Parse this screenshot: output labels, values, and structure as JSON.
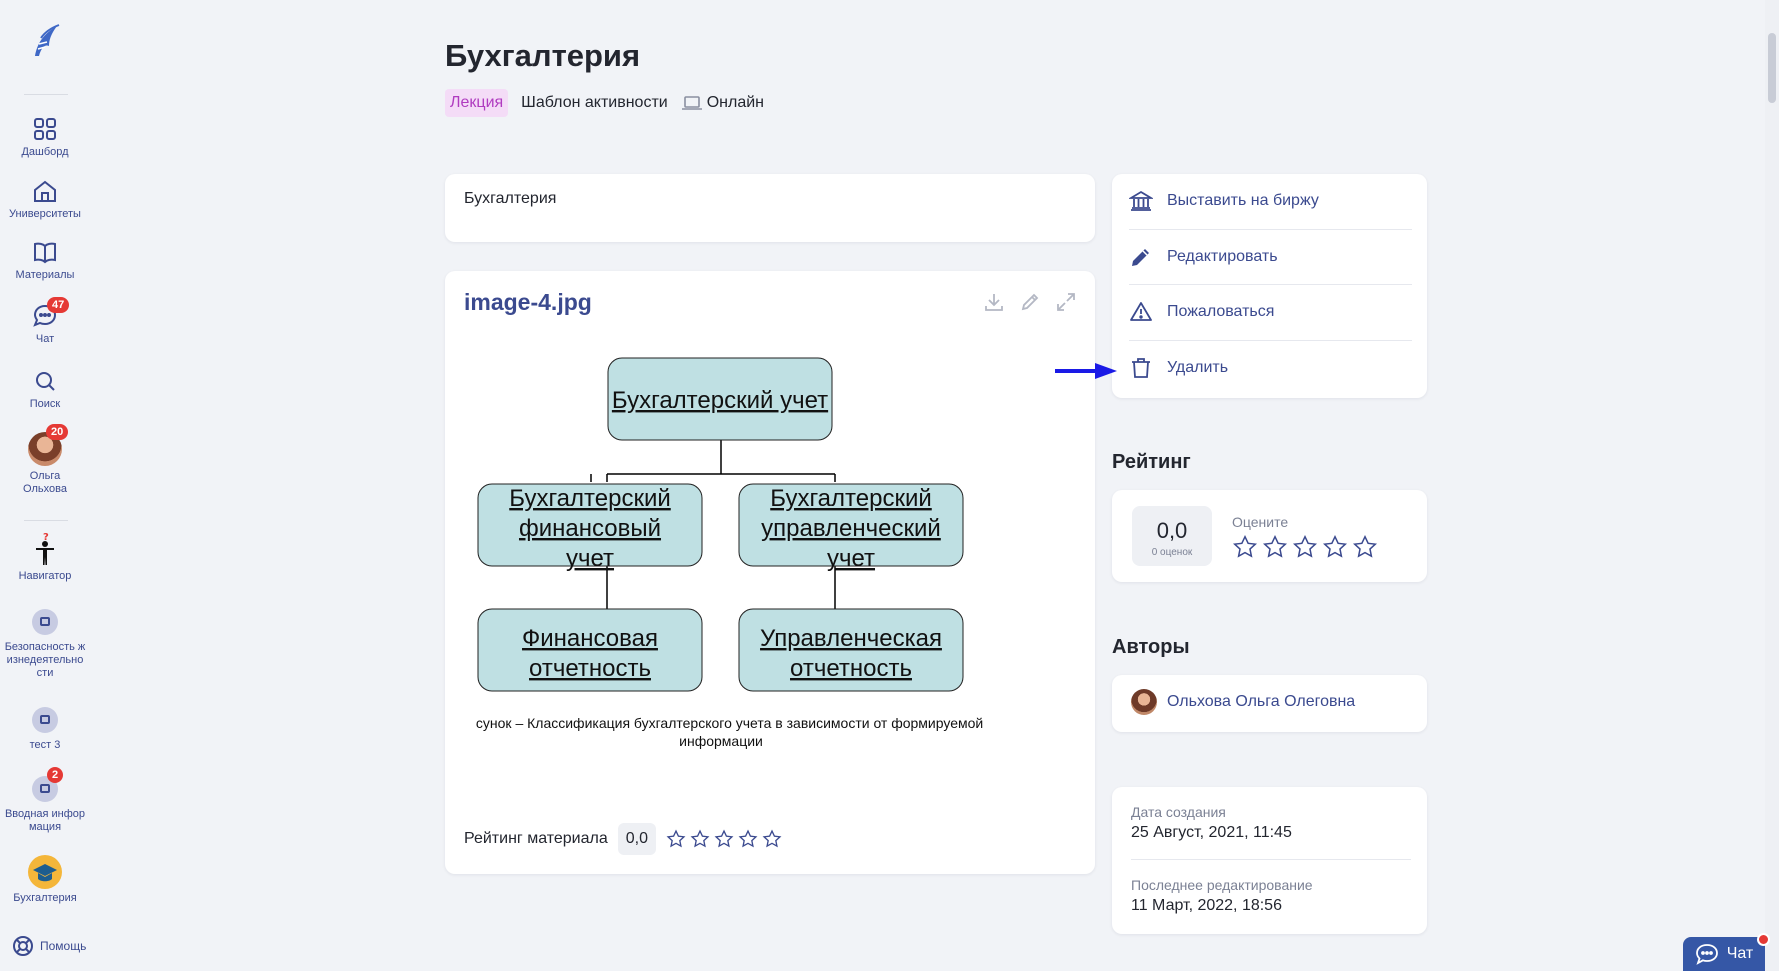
{
  "sidebar": {
    "items": [
      {
        "label": "Дашборд",
        "icon": "dashboard-icon"
      },
      {
        "label": "Университеты",
        "icon": "university-icon"
      },
      {
        "label": "Материалы",
        "icon": "book-icon"
      },
      {
        "label": "Чат",
        "icon": "chat-icon",
        "badge": "47"
      },
      {
        "label": "Поиск",
        "icon": "search-icon"
      },
      {
        "label": "Ольга Ольхова",
        "icon": "user-avatar",
        "badge": "20"
      },
      {
        "label": "Навигатор",
        "icon": "navigator-icon"
      },
      {
        "label": "Безопасность жизнедеятельности",
        "icon": "course-icon"
      },
      {
        "label": "тест 3",
        "icon": "course-icon"
      },
      {
        "label": "Вводная информация",
        "icon": "course-icon",
        "badge": "2"
      },
      {
        "label": "Бухгалтерия",
        "icon": "graduation-cap-icon"
      }
    ],
    "help_label": "Помощь"
  },
  "header": {
    "title": "Бухгалтерия",
    "tags": {
      "lecture": "Лекция",
      "template": "Шаблон активности",
      "online": "Онлайн"
    }
  },
  "description": "Бухгалтерия",
  "file": {
    "name": "image-4.jpg",
    "diagram": {
      "root": [
        "Бухгалтерский учет"
      ],
      "left_mid": [
        "Бухгалтерский",
        "финансовый",
        "учет"
      ],
      "right_mid": [
        "Бухгалтерский",
        "управленческий",
        "учет"
      ],
      "left_bottom": [
        "Финансовая",
        "отчетность"
      ],
      "right_bottom": [
        "Управленческая",
        "отчетность"
      ],
      "caption": [
        "Рисунок – Классификация бухгалтерского учета в зависимости от формируемой",
        "информации"
      ]
    },
    "rating_label": "Рейтинг материала",
    "rating_value": "0,0",
    "stars": 0
  },
  "actions": {
    "exchange": "Выставить на биржу",
    "edit": "Редактировать",
    "report": "Пожаловаться",
    "delete": "Удалить"
  },
  "rating": {
    "title": "Рейтинг",
    "value": "0,0",
    "count": "0 оценок",
    "rate_label": "Оцените",
    "stars": 0
  },
  "authors": {
    "title": "Авторы",
    "name": "Ольхова Ольга Олеговна"
  },
  "dates": {
    "created_label": "Дата создания",
    "created": "25 Август, 2021, 11:45",
    "edited_label": "Последнее редактирование",
    "edited": "11 Март, 2022, 18:56"
  },
  "chat_button": "Чат",
  "colors": {
    "accent": "#3b4a8f",
    "badge": "#e53935",
    "node_fill": "#bfe0e3",
    "lecture_tag": "#b03cc0"
  }
}
